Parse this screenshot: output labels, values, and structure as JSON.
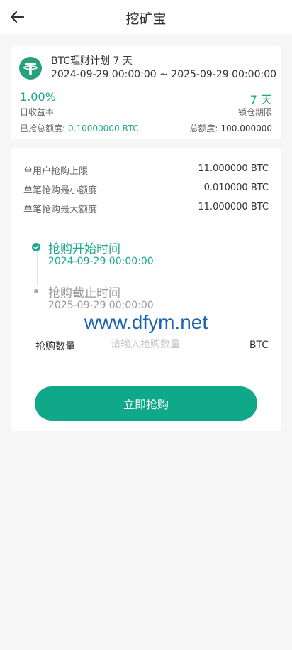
{
  "header": {
    "title": "挖矿宝",
    "back_icon": "arrow-left-icon"
  },
  "plan": {
    "icon": "tether-coin-icon",
    "name": "BTC理财计划 7 天",
    "date_range": "2024-09-29 00:00:00 ~ 2025-09-29 00:00:00",
    "daily_rate": "1.00%",
    "daily_rate_label": "日收益率",
    "lock_period": "7 天",
    "lock_period_label": "锁仓期限",
    "grabbed_label": "已抢总额度:",
    "grabbed_value": "0.10000000 BTC",
    "total_label": "总额度:",
    "total_value": "100.000000"
  },
  "limits": [
    {
      "label": "单用户抢购上限",
      "value": "11.000000 BTC"
    },
    {
      "label": "单笔抢购最小额度",
      "value": "0.010000 BTC"
    },
    {
      "label": "单笔抢购最大额度",
      "value": "11.000000 BTC"
    }
  ],
  "timeline": {
    "start_title": "抢购开始时间",
    "start_date": "2024-09-29 00:00:00",
    "end_title": "抢购截止时间",
    "end_date": "2025-09-29 00:00:00"
  },
  "watermark": "www.dfym.net",
  "purchase": {
    "amount_label": "抢购数量",
    "amount_placeholder": "请输入抢购数量",
    "amount_value": "",
    "unit": "BTC",
    "button_label": "立即抢购"
  },
  "colors": {
    "accent": "#1ea78b",
    "button": "#0fa98a",
    "watermark": "#1f63ae"
  }
}
